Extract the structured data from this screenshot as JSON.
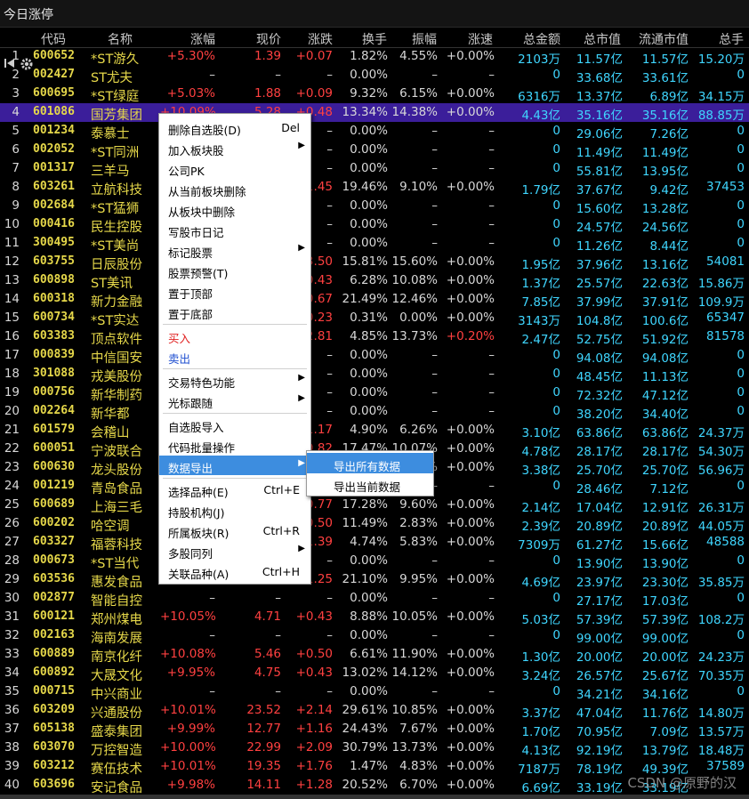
{
  "window": {
    "title": "今日涨停"
  },
  "columns": [
    "代码",
    "名称",
    "涨幅",
    "现价",
    "涨跌",
    "换手",
    "振幅",
    "涨速",
    "总金额",
    "总市值",
    "流通市值",
    "总手"
  ],
  "rows": [
    {
      "n": "1",
      "code": "600652",
      "name": "*ST游久",
      "pct": "+5.30%",
      "price": "1.39",
      "chg": "+0.07",
      "turn": "1.82%",
      "amp": "4.55%",
      "spd": "+0.00%",
      "amt": "2103",
      "amtu": "万",
      "mcap": "11.57",
      "mcapu": "亿",
      "fcap": "11.57",
      "fcapu": "亿",
      "vol": "15.20",
      "volu": "万"
    },
    {
      "n": "2",
      "code": "002427",
      "name": "ST尤夫",
      "pct": "–",
      "price": "–",
      "chg": "–",
      "turn": "0.00%",
      "amp": "–",
      "spd": "–",
      "amt": "0",
      "amtu": "",
      "mcap": "33.68",
      "mcapu": "亿",
      "fcap": "33.61",
      "fcapu": "亿",
      "vol": "0",
      "volu": ""
    },
    {
      "n": "3",
      "code": "600695",
      "name": "*ST绿庭",
      "pct": "+5.03%",
      "price": "1.88",
      "chg": "+0.09",
      "turn": "9.32%",
      "amp": "6.15%",
      "spd": "+0.00%",
      "amt": "6316",
      "amtu": "万",
      "mcap": "13.37",
      "mcapu": "亿",
      "fcap": "6.89",
      "fcapu": "亿",
      "vol": "34.15",
      "volu": "万"
    },
    {
      "n": "4",
      "code": "601086",
      "name": "国芳集团",
      "pct": "+10.09%",
      "price": "5.28",
      "chg": "+0.48",
      "turn": "13.34%",
      "amp": "14.38%",
      "spd": "+0.00%",
      "amt": "4.43",
      "amtu": "亿",
      "mcap": "35.16",
      "mcapu": "亿",
      "fcap": "35.16",
      "fcapu": "亿",
      "vol": "88.85",
      "volu": "万"
    },
    {
      "n": "5",
      "code": "001234",
      "name": "泰慕士",
      "pct": "",
      "price": "",
      "chg": "–",
      "turn": "0.00%",
      "amp": "–",
      "spd": "–",
      "amt": "0",
      "amtu": "",
      "mcap": "29.06",
      "mcapu": "亿",
      "fcap": "7.26",
      "fcapu": "亿",
      "vol": "0",
      "volu": ""
    },
    {
      "n": "6",
      "code": "002052",
      "name": "*ST同洲",
      "pct": "",
      "price": "",
      "chg": "–",
      "turn": "0.00%",
      "amp": "–",
      "spd": "–",
      "amt": "0",
      "amtu": "",
      "mcap": "11.49",
      "mcapu": "亿",
      "fcap": "11.49",
      "fcapu": "亿",
      "vol": "0",
      "volu": ""
    },
    {
      "n": "7",
      "code": "001317",
      "name": "三羊马",
      "pct": "",
      "price": "",
      "chg": "–",
      "turn": "0.00%",
      "amp": "–",
      "spd": "–",
      "amt": "0",
      "amtu": "",
      "mcap": "55.81",
      "mcapu": "亿",
      "fcap": "13.95",
      "fcapu": "亿",
      "vol": "0",
      "volu": ""
    },
    {
      "n": "8",
      "code": "603261",
      "name": "立航科技",
      "pct": "",
      "price": "",
      "chg": "+1.45",
      "turn": "19.46%",
      "amp": "9.10%",
      "spd": "+0.00%",
      "amt": "1.79",
      "amtu": "亿",
      "mcap": "37.67",
      "mcapu": "亿",
      "fcap": "9.42",
      "fcapu": "亿",
      "vol": "37453",
      "volu": ""
    },
    {
      "n": "9",
      "code": "002684",
      "name": "*ST猛狮",
      "pct": "",
      "price": "",
      "chg": "–",
      "turn": "0.00%",
      "amp": "–",
      "spd": "–",
      "amt": "0",
      "amtu": "",
      "mcap": "15.60",
      "mcapu": "亿",
      "fcap": "13.28",
      "fcapu": "亿",
      "vol": "0",
      "volu": ""
    },
    {
      "n": "10",
      "code": "000416",
      "name": "民生控股",
      "pct": "",
      "price": "",
      "chg": "–",
      "turn": "0.00%",
      "amp": "–",
      "spd": "–",
      "amt": "0",
      "amtu": "",
      "mcap": "24.57",
      "mcapu": "亿",
      "fcap": "24.56",
      "fcapu": "亿",
      "vol": "0",
      "volu": ""
    },
    {
      "n": "11",
      "code": "300495",
      "name": "*ST美尚",
      "pct": "",
      "price": "",
      "chg": "–",
      "turn": "0.00%",
      "amp": "–",
      "spd": "–",
      "amt": "0",
      "amtu": "",
      "mcap": "11.26",
      "mcapu": "亿",
      "fcap": "8.44",
      "fcapu": "亿",
      "vol": "0",
      "volu": ""
    },
    {
      "n": "12",
      "code": "603755",
      "name": "日辰股份",
      "pct": "",
      "price": "",
      "chg": "+3.50",
      "turn": "15.81%",
      "amp": "15.60%",
      "spd": "+0.00%",
      "amt": "1.95",
      "amtu": "亿",
      "mcap": "37.96",
      "mcapu": "亿",
      "fcap": "13.16",
      "fcapu": "亿",
      "vol": "54081",
      "volu": ""
    },
    {
      "n": "13",
      "code": "600898",
      "name": "ST美讯",
      "pct": "",
      "price": "",
      "chg": "+0.43",
      "turn": "6.28%",
      "amp": "10.08%",
      "spd": "+0.00%",
      "amt": "1.37",
      "amtu": "亿",
      "mcap": "25.57",
      "mcapu": "亿",
      "fcap": "22.63",
      "fcapu": "亿",
      "vol": "15.86",
      "volu": "万"
    },
    {
      "n": "14",
      "code": "600318",
      "name": "新力金融",
      "pct": "",
      "price": "",
      "chg": "+0.67",
      "turn": "21.49%",
      "amp": "12.46%",
      "spd": "+0.00%",
      "amt": "7.85",
      "amtu": "亿",
      "mcap": "37.99",
      "mcapu": "亿",
      "fcap": "37.91",
      "fcapu": "亿",
      "vol": "109.9",
      "volu": "万"
    },
    {
      "n": "15",
      "code": "600734",
      "name": "*ST实达",
      "pct": "",
      "price": "",
      "chg": "+0.23",
      "turn": "0.31%",
      "amp": "0.00%",
      "spd": "+0.00%",
      "amt": "3143",
      "amtu": "万",
      "mcap": "104.8",
      "mcapu": "亿",
      "fcap": "100.6",
      "fcapu": "亿",
      "vol": "65347",
      "volu": ""
    },
    {
      "n": "16",
      "code": "603383",
      "name": "顶点软件",
      "pct": "",
      "price": "",
      "chg": "+2.81",
      "turn": "4.85%",
      "amp": "13.73%",
      "spd": "+0.20%",
      "amt": "2.47",
      "amtu": "亿",
      "mcap": "52.75",
      "mcapu": "亿",
      "fcap": "51.92",
      "fcapu": "亿",
      "vol": "81578",
      "volu": ""
    },
    {
      "n": "17",
      "code": "000839",
      "name": "中信国安",
      "pct": "",
      "price": "",
      "chg": "–",
      "turn": "0.00%",
      "amp": "–",
      "spd": "–",
      "amt": "0",
      "amtu": "",
      "mcap": "94.08",
      "mcapu": "亿",
      "fcap": "94.08",
      "fcapu": "亿",
      "vol": "0",
      "volu": ""
    },
    {
      "n": "18",
      "code": "301088",
      "name": "戎美股份",
      "pct": "",
      "price": "",
      "chg": "–",
      "turn": "0.00%",
      "amp": "–",
      "spd": "–",
      "amt": "0",
      "amtu": "",
      "mcap": "48.45",
      "mcapu": "亿",
      "fcap": "11.13",
      "fcapu": "亿",
      "vol": "0",
      "volu": ""
    },
    {
      "n": "19",
      "code": "000756",
      "name": "新华制药",
      "pct": "",
      "price": "",
      "chg": "–",
      "turn": "0.00%",
      "amp": "–",
      "spd": "–",
      "amt": "0",
      "amtu": "",
      "mcap": "72.32",
      "mcapu": "亿",
      "fcap": "47.12",
      "fcapu": "亿",
      "vol": "0",
      "volu": ""
    },
    {
      "n": "20",
      "code": "002264",
      "name": "新华都",
      "pct": "",
      "price": "",
      "chg": "–",
      "turn": "0.00%",
      "amp": "–",
      "spd": "–",
      "amt": "0",
      "amtu": "",
      "mcap": "38.20",
      "mcapu": "亿",
      "fcap": "34.40",
      "fcapu": "亿",
      "vol": "0",
      "volu": ""
    },
    {
      "n": "21",
      "code": "601579",
      "name": "会稽山",
      "pct": "",
      "price": "",
      "chg": "+1.17",
      "turn": "4.90%",
      "amp": "6.26%",
      "spd": "+0.00%",
      "amt": "3.10",
      "amtu": "亿",
      "mcap": "63.86",
      "mcapu": "亿",
      "fcap": "63.86",
      "fcapu": "亿",
      "vol": "24.37",
      "volu": "万"
    },
    {
      "n": "22",
      "code": "600051",
      "name": "宁波联合",
      "pct": "",
      "price": "",
      "chg": "+0.82",
      "turn": "17.47%",
      "amp": "10.07%",
      "spd": "+0.00%",
      "amt": "4.78",
      "amtu": "亿",
      "mcap": "28.17",
      "mcapu": "亿",
      "fcap": "28.17",
      "fcapu": "亿",
      "vol": "54.30",
      "volu": "万"
    },
    {
      "n": "23",
      "code": "600630",
      "name": "龙头股份",
      "pct": "",
      "price": "",
      "chg": "+0.48",
      "turn": "13.31%",
      "amp": "10.88%",
      "spd": "+0.00%",
      "amt": "3.38",
      "amtu": "亿",
      "mcap": "25.70",
      "mcapu": "亿",
      "fcap": "25.70",
      "fcapu": "亿",
      "vol": "56.96",
      "volu": "万"
    },
    {
      "n": "24",
      "code": "001219",
      "name": "青岛食品",
      "pct": "",
      "price": "",
      "chg": "–",
      "turn": "0.00%",
      "amp": "–",
      "spd": "–",
      "amt": "0",
      "amtu": "",
      "mcap": "28.46",
      "mcapu": "亿",
      "fcap": "7.12",
      "fcapu": "亿",
      "vol": "0",
      "volu": ""
    },
    {
      "n": "25",
      "code": "600689",
      "name": "上海三毛",
      "pct": "",
      "price": "",
      "chg": "+0.77",
      "turn": "17.28%",
      "amp": "9.60%",
      "spd": "+0.00%",
      "amt": "2.14",
      "amtu": "亿",
      "mcap": "17.04",
      "mcapu": "亿",
      "fcap": "12.91",
      "fcapu": "亿",
      "vol": "26.31",
      "volu": "万"
    },
    {
      "n": "26",
      "code": "600202",
      "name": "哈空调",
      "pct": "",
      "price": "",
      "chg": "+0.50",
      "turn": "11.49%",
      "amp": "2.83%",
      "spd": "+0.00%",
      "amt": "2.39",
      "amtu": "亿",
      "mcap": "20.89",
      "mcapu": "亿",
      "fcap": "20.89",
      "fcapu": "亿",
      "vol": "44.05",
      "volu": "万"
    },
    {
      "n": "27",
      "code": "603327",
      "name": "福蓉科技",
      "pct": "",
      "price": "",
      "chg": "+1.39",
      "turn": "4.74%",
      "amp": "5.83%",
      "spd": "+0.00%",
      "amt": "7309",
      "amtu": "万",
      "mcap": "61.27",
      "mcapu": "亿",
      "fcap": "15.66",
      "fcapu": "亿",
      "vol": "48588",
      "volu": ""
    },
    {
      "n": "28",
      "code": "000673",
      "name": "*ST当代",
      "pct": "",
      "price": "",
      "chg": "–",
      "turn": "0.00%",
      "amp": "–",
      "spd": "–",
      "amt": "0",
      "amtu": "",
      "mcap": "13.90",
      "mcapu": "亿",
      "fcap": "13.90",
      "fcapu": "亿",
      "vol": "0",
      "volu": ""
    },
    {
      "n": "29",
      "code": "603536",
      "name": "惠发食品",
      "pct": "",
      "price": "",
      "chg": "+1.25",
      "turn": "21.10%",
      "amp": "9.95%",
      "spd": "+0.00%",
      "amt": "4.69",
      "amtu": "亿",
      "mcap": "23.97",
      "mcapu": "亿",
      "fcap": "23.30",
      "fcapu": "亿",
      "vol": "35.85",
      "volu": "万"
    },
    {
      "n": "30",
      "code": "002877",
      "name": "智能自控",
      "pct": "–",
      "price": "–",
      "chg": "–",
      "turn": "0.00%",
      "amp": "–",
      "spd": "–",
      "amt": "0",
      "amtu": "",
      "mcap": "27.17",
      "mcapu": "亿",
      "fcap": "17.03",
      "fcapu": "亿",
      "vol": "0",
      "volu": ""
    },
    {
      "n": "31",
      "code": "600121",
      "name": "郑州煤电",
      "pct": "+10.05%",
      "price": "4.71",
      "chg": "+0.43",
      "turn": "8.88%",
      "amp": "10.05%",
      "spd": "+0.00%",
      "amt": "5.03",
      "amtu": "亿",
      "mcap": "57.39",
      "mcapu": "亿",
      "fcap": "57.39",
      "fcapu": "亿",
      "vol": "108.2",
      "volu": "万"
    },
    {
      "n": "32",
      "code": "002163",
      "name": "海南发展",
      "pct": "–",
      "price": "–",
      "chg": "–",
      "turn": "0.00%",
      "amp": "–",
      "spd": "–",
      "amt": "0",
      "amtu": "",
      "mcap": "99.00",
      "mcapu": "亿",
      "fcap": "99.00",
      "fcapu": "亿",
      "vol": "0",
      "volu": ""
    },
    {
      "n": "33",
      "code": "600889",
      "name": "南京化纤",
      "pct": "+10.08%",
      "price": "5.46",
      "chg": "+0.50",
      "turn": "6.61%",
      "amp": "11.90%",
      "spd": "+0.00%",
      "amt": "1.30",
      "amtu": "亿",
      "mcap": "20.00",
      "mcapu": "亿",
      "fcap": "20.00",
      "fcapu": "亿",
      "vol": "24.23",
      "volu": "万"
    },
    {
      "n": "34",
      "code": "600892",
      "name": "大晟文化",
      "pct": "+9.95%",
      "price": "4.75",
      "chg": "+0.43",
      "turn": "13.02%",
      "amp": "14.12%",
      "spd": "+0.00%",
      "amt": "3.24",
      "amtu": "亿",
      "mcap": "26.57",
      "mcapu": "亿",
      "fcap": "25.67",
      "fcapu": "亿",
      "vol": "70.35",
      "volu": "万"
    },
    {
      "n": "35",
      "code": "000715",
      "name": "中兴商业",
      "pct": "–",
      "price": "–",
      "chg": "–",
      "turn": "0.00%",
      "amp": "–",
      "spd": "–",
      "amt": "0",
      "amtu": "",
      "mcap": "34.21",
      "mcapu": "亿",
      "fcap": "34.16",
      "fcapu": "亿",
      "vol": "0",
      "volu": ""
    },
    {
      "n": "36",
      "code": "603209",
      "name": "兴通股份",
      "pct": "+10.01%",
      "price": "23.52",
      "chg": "+2.14",
      "turn": "29.61%",
      "amp": "10.85%",
      "spd": "+0.00%",
      "amt": "3.37",
      "amtu": "亿",
      "mcap": "47.04",
      "mcapu": "亿",
      "fcap": "11.76",
      "fcapu": "亿",
      "vol": "14.80",
      "volu": "万"
    },
    {
      "n": "37",
      "code": "605138",
      "name": "盛泰集团",
      "pct": "+9.99%",
      "price": "12.77",
      "chg": "+1.16",
      "turn": "24.43%",
      "amp": "7.67%",
      "spd": "+0.00%",
      "amt": "1.70",
      "amtu": "亿",
      "mcap": "70.95",
      "mcapu": "亿",
      "fcap": "7.09",
      "fcapu": "亿",
      "vol": "13.57",
      "volu": "万"
    },
    {
      "n": "38",
      "code": "603070",
      "name": "万控智造",
      "pct": "+10.00%",
      "price": "22.99",
      "chg": "+2.09",
      "turn": "30.79%",
      "amp": "13.73%",
      "spd": "+0.00%",
      "amt": "4.13",
      "amtu": "亿",
      "mcap": "92.19",
      "mcapu": "亿",
      "fcap": "13.79",
      "fcapu": "亿",
      "vol": "18.48",
      "volu": "万"
    },
    {
      "n": "39",
      "code": "603212",
      "name": "赛伍技术",
      "pct": "+10.01%",
      "price": "19.35",
      "chg": "+1.76",
      "turn": "1.47%",
      "amp": "4.83%",
      "spd": "+0.00%",
      "amt": "7187",
      "amtu": "万",
      "mcap": "78.19",
      "mcapu": "亿",
      "fcap": "49.39",
      "fcapu": "亿",
      "vol": "37589",
      "volu": ""
    },
    {
      "n": "40",
      "code": "603696",
      "name": "安记食品",
      "pct": "+9.98%",
      "price": "14.11",
      "chg": "+1.28",
      "turn": "20.52%",
      "amp": "6.70%",
      "spd": "+0.00%",
      "amt": "6.69",
      "amtu": "亿",
      "mcap": "33.19",
      "mcapu": "亿",
      "fcap": "33.19",
      "fcapu": "亿",
      "vol": "",
      "volu": ""
    }
  ],
  "context_menu": [
    {
      "label": "删除自选股(D)",
      "shortcut": "Del"
    },
    {
      "label": "加入板块股",
      "arrow": "▶"
    },
    {
      "label": "公司PK"
    },
    {
      "label": "从当前板块删除"
    },
    {
      "label": "从板块中删除"
    },
    {
      "label": "写股市日记"
    },
    {
      "label": "标记股票",
      "arrow": "▶"
    },
    {
      "label": "股票预警(T)"
    },
    {
      "label": "置于顶部"
    },
    {
      "label": "置于底部"
    },
    {
      "label": "买入",
      "color": "red"
    },
    {
      "label": "卖出",
      "color": "blue"
    },
    {
      "label": "交易特色功能",
      "arrow": "▶"
    },
    {
      "label": "光标跟随",
      "arrow": "▶"
    },
    {
      "label": "自选股导入"
    },
    {
      "label": "代码批量操作"
    },
    {
      "label": "数据导出",
      "arrow": "▶"
    },
    {
      "label": "选择品种(E)",
      "shortcut": "Ctrl+E"
    },
    {
      "label": "持股机构(J)"
    },
    {
      "label": "所属板块(R)",
      "shortcut": "Ctrl+R"
    },
    {
      "label": "多股同列",
      "arrow": "▶"
    },
    {
      "label": "关联品种(A)",
      "shortcut": "Ctrl+H"
    }
  ],
  "submenu": [
    {
      "label": "导出所有数据"
    },
    {
      "label": "导出当前数据"
    }
  ],
  "watermark": "CSDN @原野的汉",
  "icons": {
    "back": "back-to-start-icon",
    "settings": "gear-icon"
  },
  "colors": {
    "up": "#ff4040",
    "cyan": "#3fd6ff",
    "code": "#e6d84a",
    "selected": "#3b1e9a",
    "menu_highlight": "#3d8ddf"
  }
}
